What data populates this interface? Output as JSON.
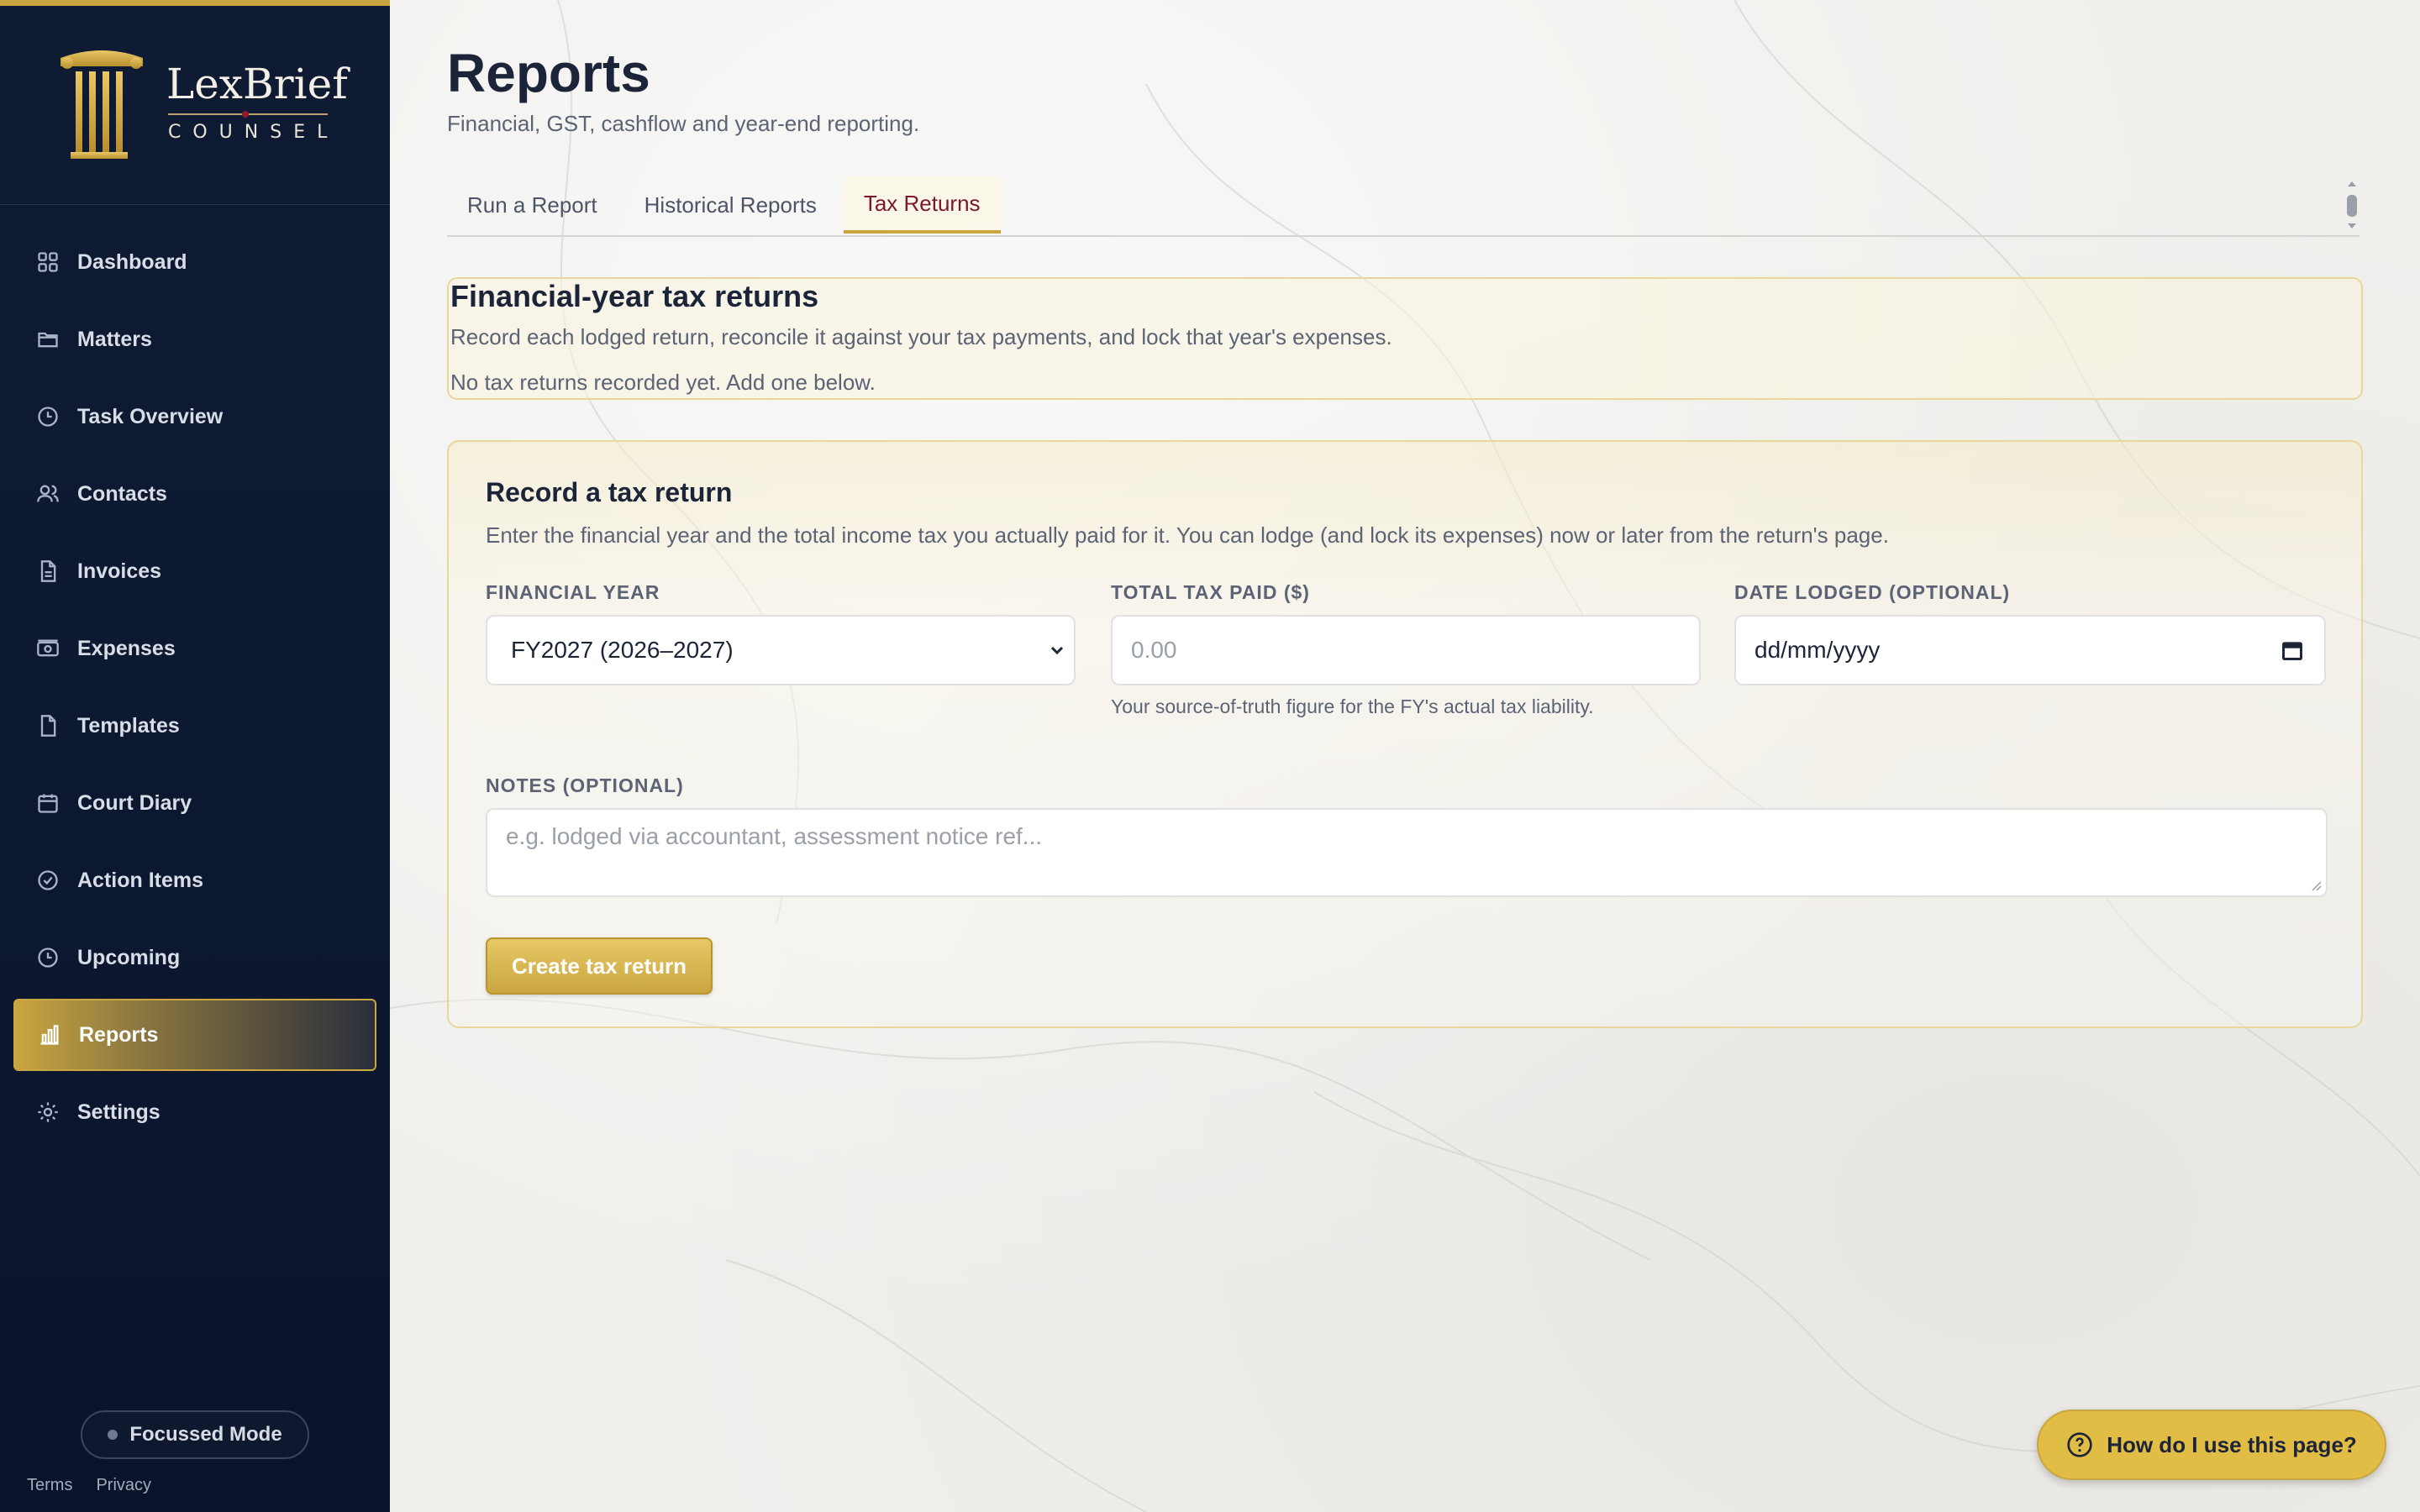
{
  "brand": {
    "name": "LexBrief",
    "sub": "COUNSEL"
  },
  "sidebar": {
    "items": [
      {
        "label": "Dashboard",
        "icon": "grid-icon"
      },
      {
        "label": "Matters",
        "icon": "folder-icon"
      },
      {
        "label": "Task Overview",
        "icon": "clock-icon"
      },
      {
        "label": "Contacts",
        "icon": "users-icon"
      },
      {
        "label": "Invoices",
        "icon": "document-icon"
      },
      {
        "label": "Expenses",
        "icon": "banknote-icon"
      },
      {
        "label": "Templates",
        "icon": "file-icon"
      },
      {
        "label": "Court Diary",
        "icon": "calendar-icon"
      },
      {
        "label": "Action Items",
        "icon": "check-circle-icon"
      },
      {
        "label": "Upcoming",
        "icon": "clock-icon"
      },
      {
        "label": "Reports",
        "icon": "bar-chart-icon",
        "active": true
      },
      {
        "label": "Settings",
        "icon": "gear-icon"
      }
    ],
    "focus_mode": "Focussed Mode",
    "footer": {
      "terms": "Terms",
      "privacy": "Privacy"
    }
  },
  "header": {
    "title": "Reports",
    "subtitle": "Financial, GST, cashflow and year-end reporting."
  },
  "tabs": [
    {
      "label": "Run a Report"
    },
    {
      "label": "Historical Reports"
    },
    {
      "label": "Tax Returns",
      "active": true
    }
  ],
  "summary": {
    "title": "Financial-year tax returns",
    "description": "Record each lodged return, reconcile it against your tax payments, and lock that year's expenses.",
    "empty": "No tax returns recorded yet. Add one below."
  },
  "form": {
    "title": "Record a tax return",
    "description": "Enter the financial year and the total income tax you actually paid for it. You can lodge (and lock its expenses) now or later from the return's page.",
    "financial_year": {
      "label": "FINANCIAL YEAR",
      "value": "FY2027 (2026–2027)"
    },
    "total_tax": {
      "label": "TOTAL TAX PAID ($)",
      "placeholder": "0.00",
      "help": "Your source-of-truth figure for the FY's actual tax liability."
    },
    "date_lodged": {
      "label": "DATE LODGED (OPTIONAL)",
      "placeholder": "dd/mm/yyyy"
    },
    "notes": {
      "label": "NOTES (OPTIONAL)",
      "placeholder": "e.g. lodged via accountant, assessment notice ref..."
    },
    "submit": "Create tax return"
  },
  "help": {
    "label": "How do I use this page?"
  },
  "colors": {
    "accent": "#c9a63f",
    "sidebar": "#0f1b33",
    "active_tab_text": "#7b1730"
  }
}
